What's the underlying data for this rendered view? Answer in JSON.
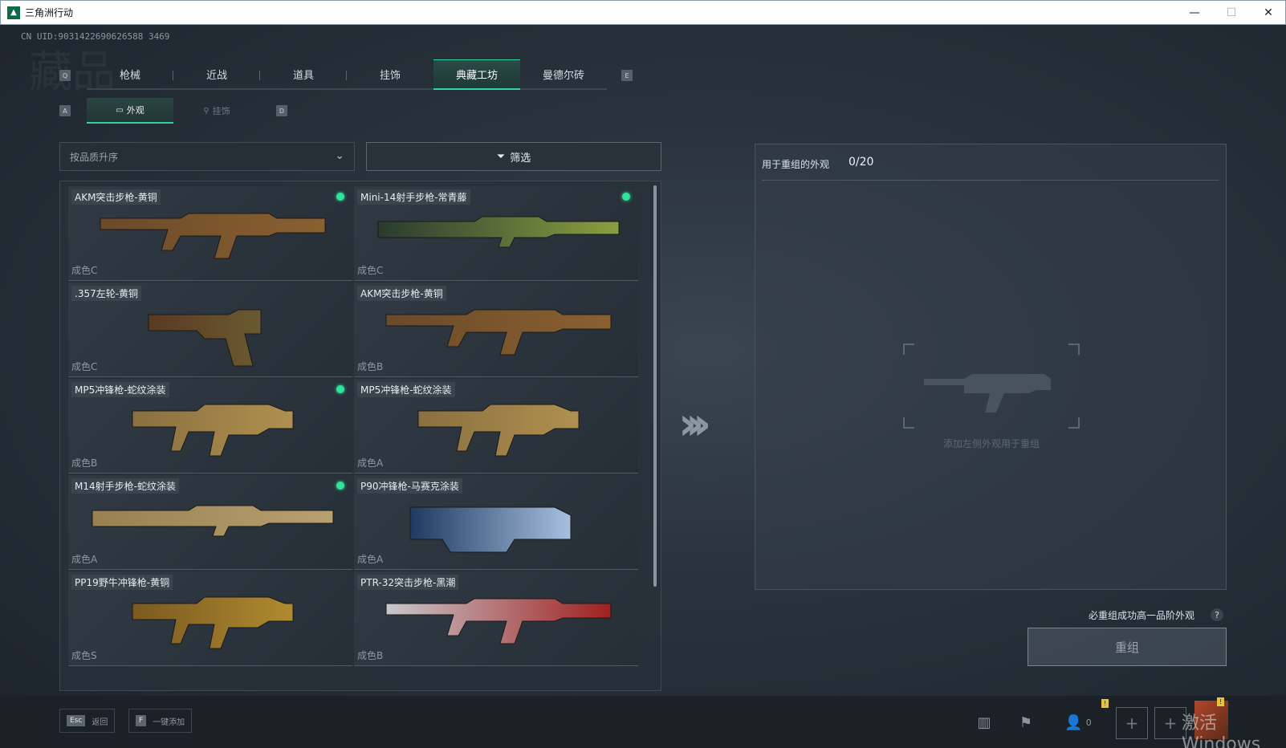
{
  "window": {
    "title": "三角洲行动",
    "minimize": "—",
    "maximize": "☐",
    "close": "✕"
  },
  "uid": "CN UID:9031422690626588 3469",
  "bg_text": "藏品",
  "keys": {
    "main_left": "Q",
    "main_right": "E",
    "sub_left": "A",
    "sub_right": "D"
  },
  "main_tabs": [
    {
      "label": "枪械",
      "active": false
    },
    {
      "label": "近战",
      "active": false
    },
    {
      "label": "道具",
      "active": false
    },
    {
      "label": "挂饰",
      "active": false
    },
    {
      "label": "典藏工坊",
      "active": true
    },
    {
      "label": "曼德尔砖",
      "active": false
    }
  ],
  "sub_tabs": [
    {
      "label": "外观",
      "icon": "image-icon",
      "active": true
    },
    {
      "label": "挂饰",
      "icon": "charm-icon",
      "active": false
    }
  ],
  "sort": {
    "value": "按品质升序"
  },
  "filter": {
    "label": "筛选"
  },
  "items": [
    {
      "name": "AKM突击步枪-黄铜",
      "grade": "成色C",
      "new": true
    },
    {
      "name": "Mini-14射手步枪-常青藤",
      "grade": "成色C",
      "new": true
    },
    {
      "name": ".357左轮-黄铜",
      "grade": "成色C",
      "new": false
    },
    {
      "name": "AKM突击步枪-黄铜",
      "grade": "成色B",
      "new": false
    },
    {
      "name": "MP5冲锋枪-蛇纹涂装",
      "grade": "成色B",
      "new": true
    },
    {
      "name": "MP5冲锋枪-蛇纹涂装",
      "grade": "成色A",
      "new": false
    },
    {
      "name": "M14射手步枪-蛇纹涂装",
      "grade": "成色A",
      "new": true
    },
    {
      "name": "P90冲锋枪-马赛克涂装",
      "grade": "成色A",
      "new": false
    },
    {
      "name": "PP19野牛冲锋枪-黄铜",
      "grade": "成色S",
      "new": false
    },
    {
      "name": "PTR-32突击步枪-黑潮",
      "grade": "成色B",
      "new": false
    }
  ],
  "right_panel": {
    "header": "用于重组的外观",
    "count": "0/20",
    "empty_hint": "添加左侧外观用于重组"
  },
  "guarantee": "必重组成功高一品阶外观",
  "help": "?",
  "regroup_button": "重组",
  "bottom": {
    "esc_key": "Esc",
    "esc_label": "返回",
    "f_key": "F",
    "f_label": "一键添加",
    "friends_count": "0",
    "badge": "!",
    "watermark": "激活 Windows"
  },
  "colors": {
    "accent": "#2fd4a0",
    "new_dot": "#2ee59d"
  }
}
